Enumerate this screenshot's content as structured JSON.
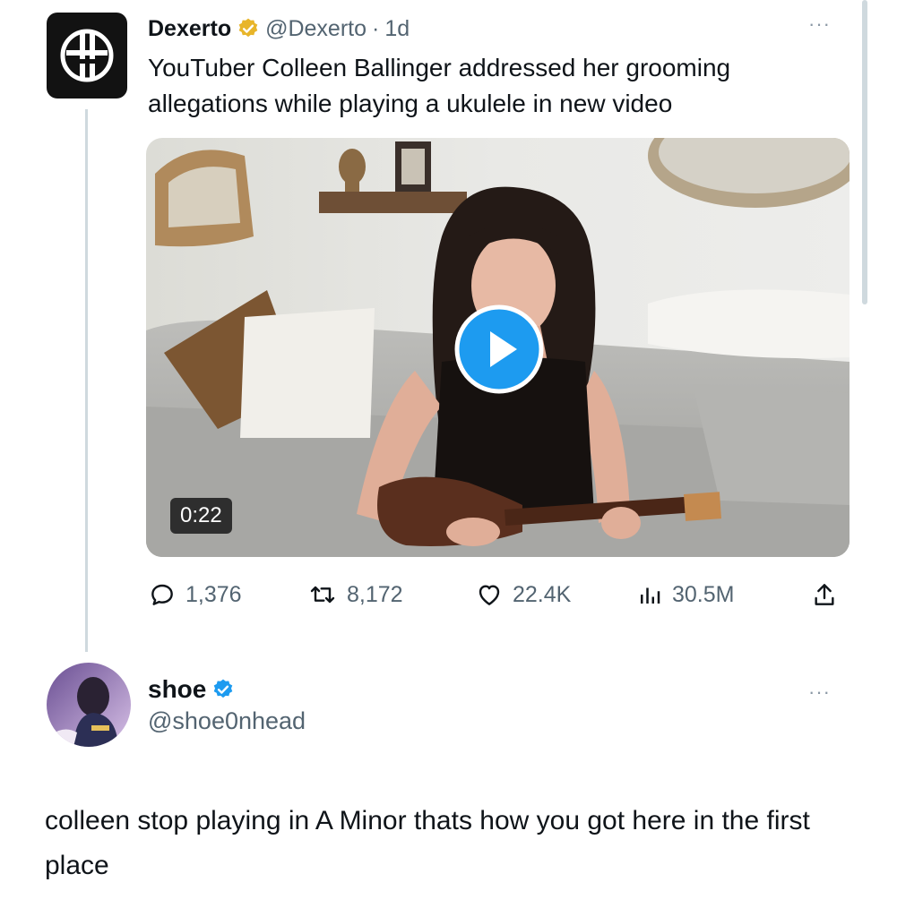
{
  "quoted_tweet": {
    "author_name": "Dexerto",
    "handle": "@Dexerto",
    "separator": "·",
    "age": "1d",
    "text": "YouTuber Colleen Ballinger addressed her grooming allegations while playing a ukulele in new video",
    "media": {
      "kind": "video",
      "duration": "0:22"
    },
    "actions": {
      "replies": "1,376",
      "retweets": "8,172",
      "likes": "22.4K",
      "views": "30.5M"
    },
    "badge_color": "#e8b52a",
    "more_label": "···"
  },
  "reply": {
    "author_name": "shoe",
    "handle": "@shoe0nhead",
    "text": "colleen stop playing in A Minor thats how you got here in the first place",
    "badge_color": "#1d9bf0",
    "more_label": "···"
  },
  "colors": {
    "accent": "#1d9bf0",
    "text_primary": "#0f1419",
    "text_secondary": "#536471"
  },
  "icons": [
    "dexerto-logo-icon",
    "verified-gold-icon",
    "play-icon",
    "reply-icon",
    "retweet-icon",
    "like-icon",
    "views-icon",
    "share-icon",
    "verified-blue-icon",
    "more-icon"
  ]
}
